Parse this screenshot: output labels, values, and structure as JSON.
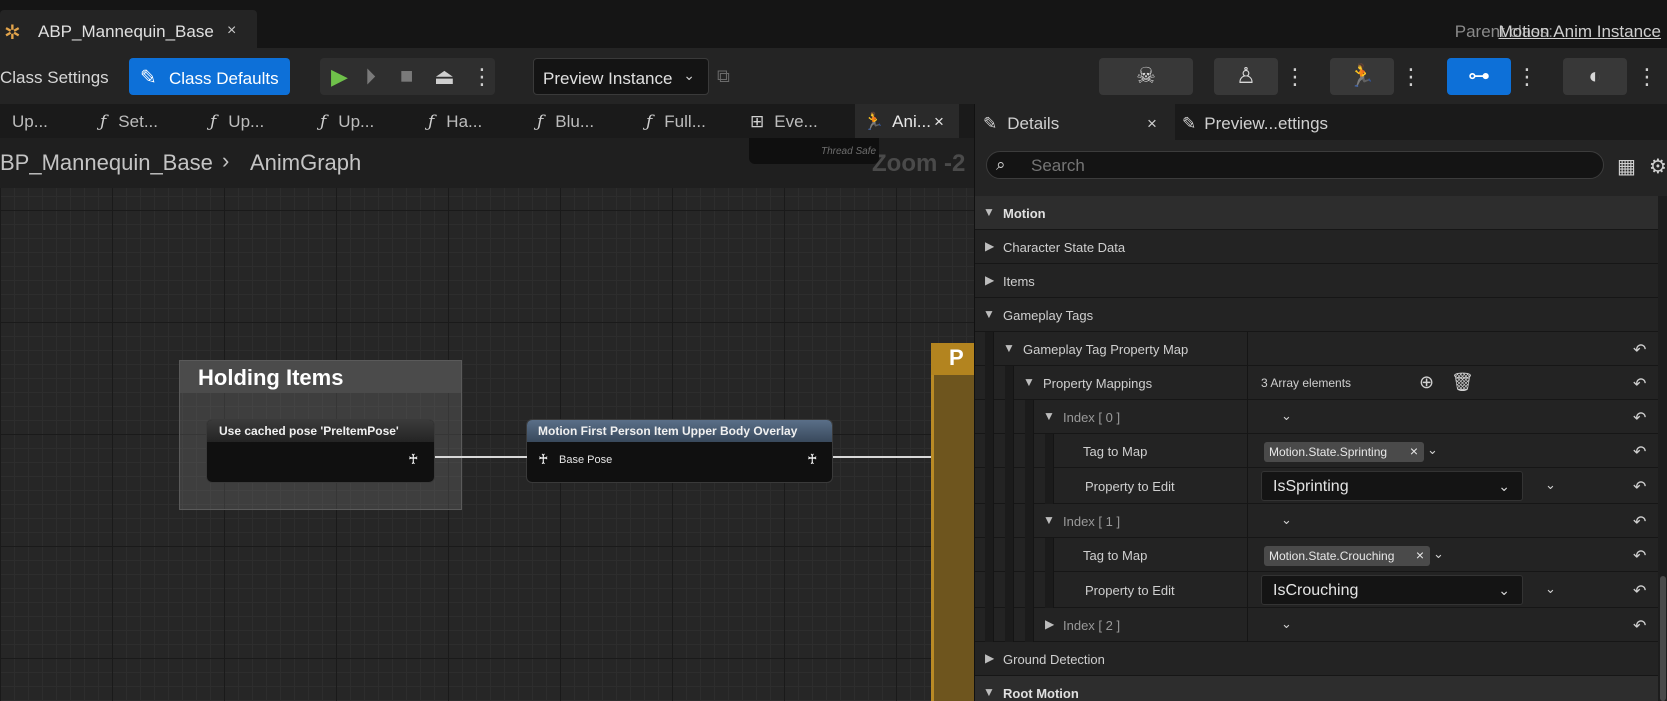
{
  "asset_tab": {
    "icon": "anim-blueprint-icon",
    "title": "ABP_Mannequin_Base",
    "close": "×"
  },
  "parent_class": {
    "label": "Parent class:",
    "value": "Motion Anim Instance"
  },
  "toolbar": {
    "class_settings": "Class Settings",
    "class_defaults": "Class Defaults",
    "preview_instance": "Preview Instance",
    "accent_color": "#0d70d8"
  },
  "graph_tabs": [
    {
      "icon": "function-icon",
      "label": "Up..."
    },
    {
      "icon": "function-icon",
      "label": "Set..."
    },
    {
      "icon": "function-icon",
      "label": "Up..."
    },
    {
      "icon": "function-icon",
      "label": "Up..."
    },
    {
      "icon": "function-icon",
      "label": "Ha..."
    },
    {
      "icon": "function-icon",
      "label": "Blu..."
    },
    {
      "icon": "function-icon",
      "label": "Full..."
    },
    {
      "icon": "event-graph-icon",
      "label": "Eve..."
    },
    {
      "icon": "anim-graph-icon",
      "label": "Ani..."
    }
  ],
  "breadcrumb": {
    "asset": "BP_Mannequin_Base",
    "graph": "AnimGraph"
  },
  "zoom": "Zoom -2",
  "graph": {
    "thread_safe": "Thread Safe",
    "comment_title": "Holding Items",
    "cached_pose_node": "Use cached pose 'PreItemPose'",
    "overlay_node": "Motion First Person Item Upper Body Overlay",
    "base_pose_pin": "Base Pose",
    "orange_node_initial": "P",
    "orange_color": "#b3841f"
  },
  "details": {
    "tab_details": "Details",
    "tab_preview": "Preview...ettings",
    "search_placeholder": "Search",
    "rows": {
      "motion": "Motion",
      "character_state_data": "Character State Data",
      "items": "Items",
      "gameplay_tags": "Gameplay Tags",
      "tag_property_map": "Gameplay Tag Property Map",
      "property_mappings": "Property Mappings",
      "array_count": "3 Array elements",
      "index0": "Index [ 0 ]",
      "tag_to_map": "Tag to Map",
      "tag0": "Motion.State.Sprinting",
      "property_to_edit": "Property to Edit",
      "prop0": "IsSprinting",
      "index1": "Index [ 1 ]",
      "tag1": "Motion.State.Crouching",
      "prop1": "IsCrouching",
      "index2": "Index [ 2 ]",
      "ground_detection": "Ground Detection",
      "root_motion": "Root Motion"
    }
  }
}
